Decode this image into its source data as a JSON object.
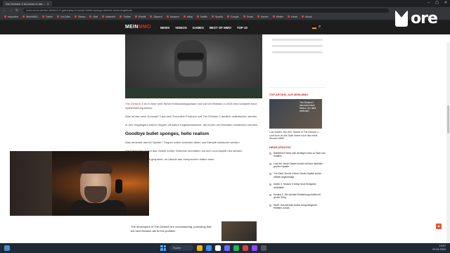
{
  "browser": {
    "active_tab": "Die Division 3 ist schon in der...",
    "tabs": [
      {
        "label": "Die Division 3 ist schon in der..."
      }
    ],
    "url": "mein-mmo.de/the-division-3-gameplay-konzept-bullet-sponge-abkehr-news-angebote",
    "bookmarks": [
      "Importiert",
      "MeinMMO",
      "Twitch",
      "YouTube",
      "Steam",
      "Mail",
      "Kalender",
      "Twitter",
      "Reddit",
      "Discord",
      "Amazon",
      "eBay",
      "Netflix",
      "Spotify",
      "Google",
      "Gmail",
      "Karten",
      "Wetter",
      "News",
      "Musik"
    ]
  },
  "site": {
    "logo_main": "MEIN",
    "logo_accent": "MMO",
    "nav": [
      "NEWS",
      "VIDEOS",
      "GAMES",
      "BEST OF MMO",
      "TOP 10"
    ],
    "article": {
      "p1_link": "The Division 3",
      "p1_text": "ist in einer sehr frühen Entwicklungsphase und soll bei Release in 2026 eine komplett neue Spielerfahrung bieten.",
      "p2_text": "Was ist das neue Konzept? Laut dem Executive Producer soll The Division 3 deutlich realistischer werden.",
      "p3_text": "In den Vorgängern waren Gegner oft wahre Kugelschwämme, die enorm viel Schaden einstecken konnten.",
      "heading": "Goodbye bullet sponges, hello realism",
      "p4_text": "Was bedeutet das für Spieler? Gegner sollen schneller fallen und Kämpfe taktischer werden.",
      "p5_text": "Die Entwickler wollen das Gefühl echter Gefechte vermitteln und den Loot-Aspekt neu denken.",
      "p6_text": "Fans der Reihe sind gespannt, ob Ubisoft das Versprechen halten kann."
    },
    "promo_text": "The developers of The Division are reconsidering, promising that the next Division will fix the problem",
    "sidebar": {
      "section1_title": "TOP-ARTIKEL AUF MEIN-MMO",
      "feature_caption": "The Division 2 bekommt einen Modus, der alles verändert",
      "feature_text": "Lost Soldier: Die 500. Stunde in The Division 2 – Laut euch ist das Spiel immer noch das beste Shooter-MMO",
      "section2_title": "NEWS-UPDATES",
      "news": [
        "Battlefield 6 Beta: Alle wichtigen Infos zu Start und Inhalten",
        "Lost Ark: Neue Klasse kommt mit dem nächsten großen Update",
        "The Elder Scrolls Online: Neues Kapitel wurde offiziell angekündigt",
        "Diablo 4: Season 5 bringt neue Endgame-Aktivitäten",
        "Destiny 2: Die nächste Erweiterung startet mit großer Story",
        "WoW: Das nächste Addon bringt fliegende Reittiere zurück"
      ]
    }
  },
  "overlay": {
    "brand_word": "ore"
  },
  "taskbar": {
    "search": "Suche",
    "time": "19:07",
    "date": "22.04.2024"
  }
}
